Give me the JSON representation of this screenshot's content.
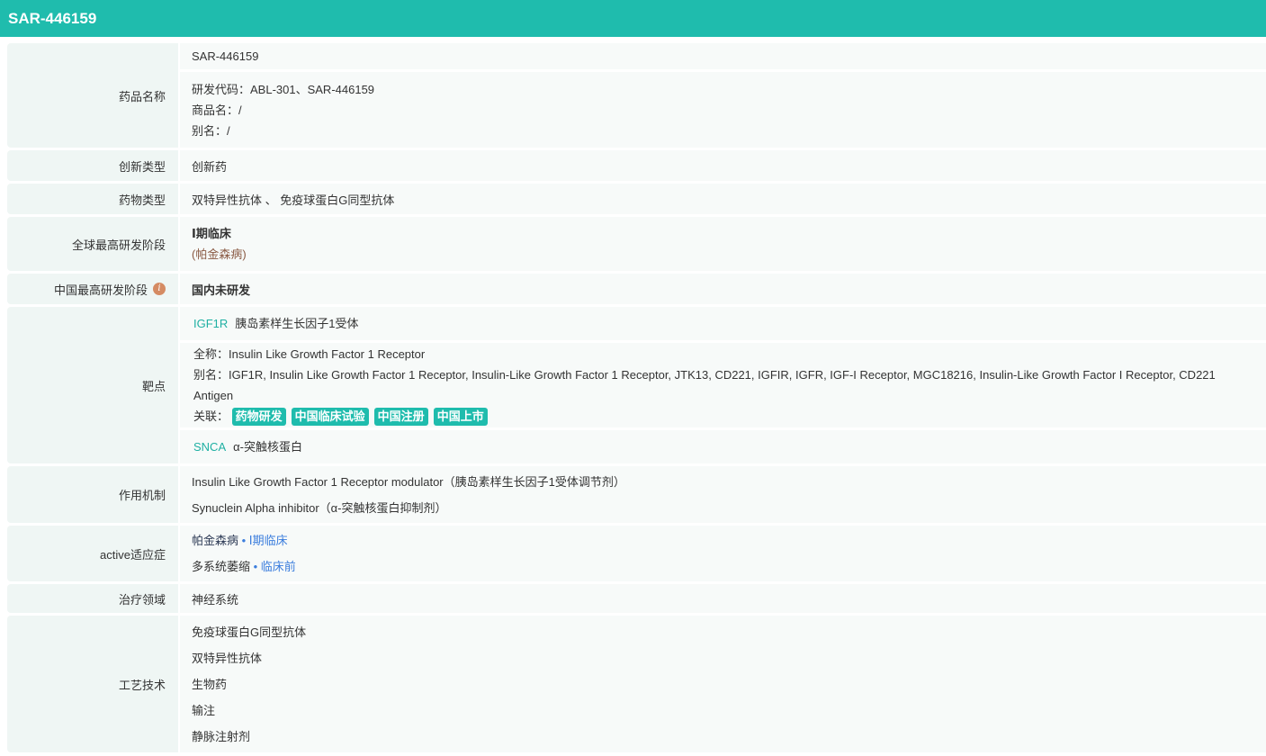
{
  "title": "SAR-446159",
  "rows": {
    "name": {
      "label": "药品名称",
      "main": "SAR-446159",
      "code": "研发代码：ABL-301、SAR-446159",
      "trade": "商品名：/",
      "alias": "别名：/"
    },
    "innovation": {
      "label": "创新类型",
      "value": "创新药"
    },
    "drug_type": {
      "label": "药物类型",
      "value": "双特异性抗体 、 免疫球蛋白G同型抗体"
    },
    "global_stage": {
      "label": "全球最高研发阶段",
      "value": "Ⅰ期临床",
      "note": "(帕金森病)"
    },
    "china_stage": {
      "label": "中国最高研发阶段",
      "value": "国内未研发",
      "info_icon": "i"
    },
    "target": {
      "label": "靶点",
      "t1_code": "IGF1R",
      "t1_name": "胰岛素样生长因子1受体",
      "full": "全称：Insulin Like Growth Factor 1 Receptor",
      "alias": "别名：IGF1R, Insulin Like Growth Factor 1 Receptor, Insulin-Like Growth Factor 1 Receptor, JTK13, CD221, IGFIR, IGFR, IGF-I Receptor, MGC18216, Insulin-Like Growth Factor I Receptor, CD221 Antigen",
      "related": "关联：",
      "tags": [
        "药物研发",
        "中国临床试验",
        "中国注册",
        "中国上市"
      ],
      "t2_code": "SNCA",
      "t2_name": "α-突触核蛋白"
    },
    "mechanism": {
      "label": "作用机制",
      "items": [
        "Insulin Like Growth Factor 1 Receptor modulator（胰岛素样生长因子1受体调节剂）",
        "Synuclein Alpha inhibitor（α-突触核蛋白抑制剂）"
      ]
    },
    "indication": {
      "label": "active适应症",
      "items": [
        {
          "name": "帕金森病",
          "stage": "Ⅰ期临床"
        },
        {
          "name": "多系统萎缩",
          "stage": "临床前"
        }
      ]
    },
    "area": {
      "label": "治疗领域",
      "value": "神经系统"
    },
    "tech": {
      "label": "工艺技术",
      "items": [
        "免疫球蛋白G同型抗体",
        "双特异性抗体",
        "生物药",
        "输注",
        "静脉注射剂"
      ]
    }
  }
}
